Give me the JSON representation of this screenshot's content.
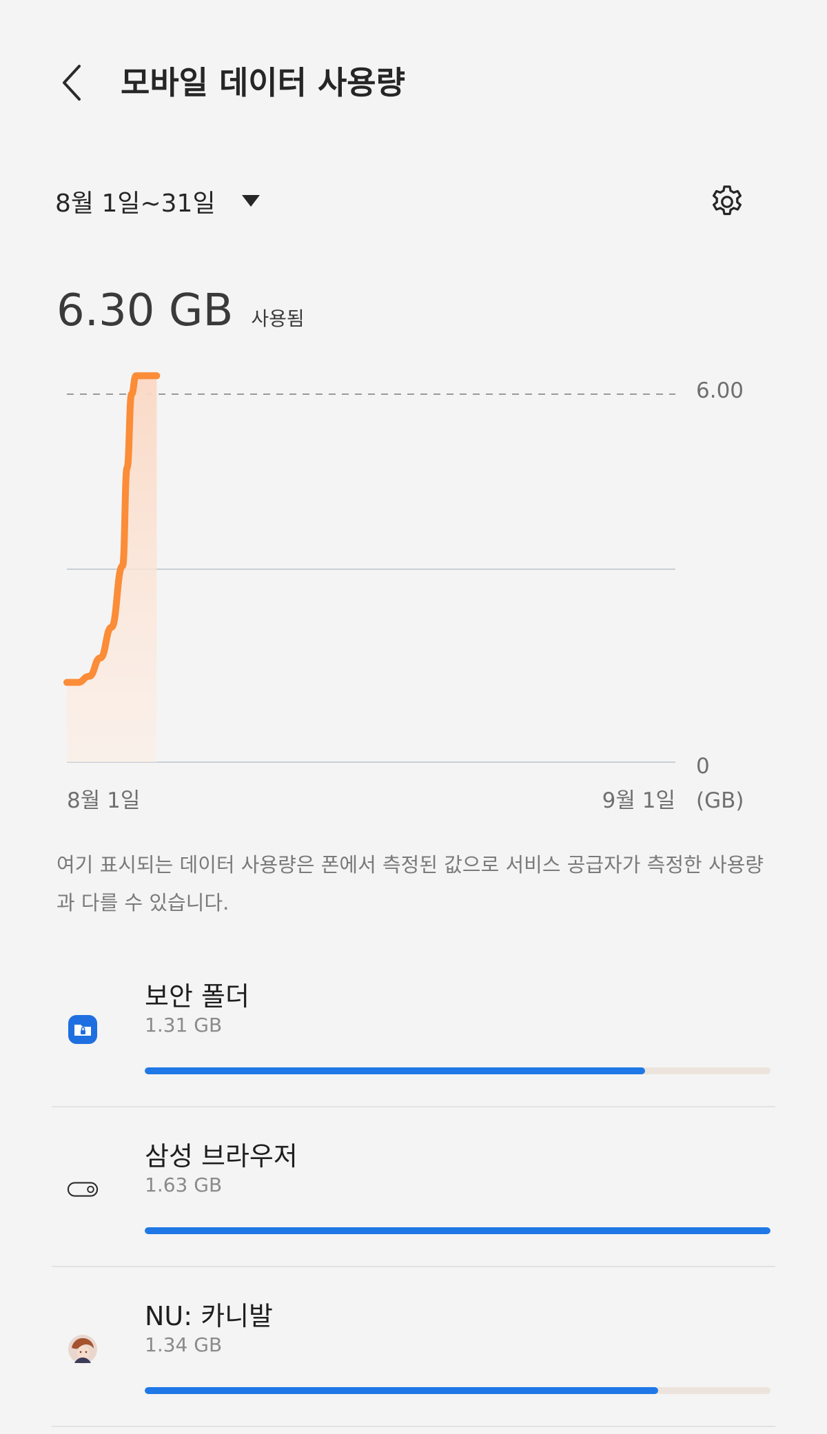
{
  "header": {
    "title": "모바일 데이터 사용량"
  },
  "period": {
    "label": "8월 1일~31일"
  },
  "total": {
    "value": "6.30 GB",
    "suffix": "사용됨"
  },
  "chart_data": {
    "type": "area",
    "unit_label": "(GB)",
    "x_start_label": "8월 1일",
    "x_end_label": "9월 1일",
    "limit_label": "6.00",
    "zero_label": "0",
    "limit_value": 6.0,
    "x_days": [
      1,
      31
    ],
    "ylim": [
      0,
      6.0
    ],
    "grid": true,
    "series": [
      {
        "color": "#fb8c38",
        "x": [
          1,
          2,
          3,
          4,
          5,
          6,
          6.4,
          6.8,
          7.2
        ],
        "y": [
          1.3,
          1.3,
          1.4,
          1.7,
          2.2,
          3.2,
          4.8,
          6.0,
          6.3
        ]
      }
    ]
  },
  "disclaimer": "여기 표시되는 데이터 사용량은 폰에서 측정된 값으로 서비스 공급자가 측정한 사용량과 다를 수 있습니다.",
  "apps": [
    {
      "name": "보안 폴더",
      "size": "1.31 GB",
      "usage_fraction": 0.8,
      "icon": "secure-folder-icon"
    },
    {
      "name": "삼성 브라우저",
      "size": "1.63 GB",
      "usage_fraction": 1.0,
      "icon": "browser-toggle-icon"
    },
    {
      "name": "NU: 카니발",
      "size": "1.34 GB",
      "usage_fraction": 0.82,
      "icon": "game-avatar-icon"
    }
  ],
  "colors": {
    "accent_orange": "#fb8c38",
    "usage_bar_blue": "#1f78e6",
    "background": "#f4f4f4"
  }
}
